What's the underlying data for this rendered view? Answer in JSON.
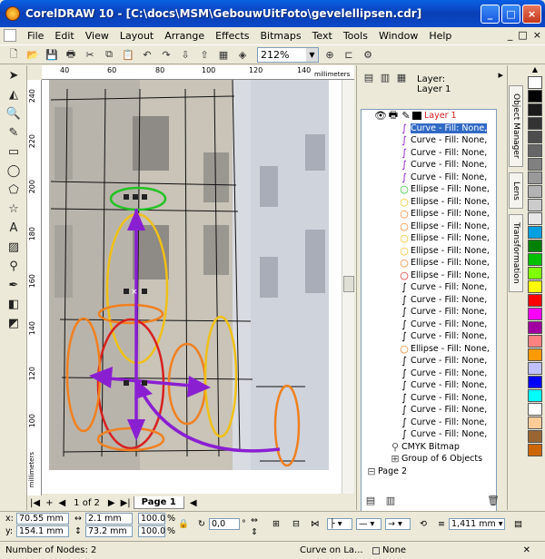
{
  "window": {
    "title": "CorelDRAW 10 - [C:\\docs\\MSM\\GebouwUitFoto\\gevelellipsen.cdr]",
    "minimize": "_",
    "restore": "□",
    "close": "×"
  },
  "menu": [
    "File",
    "Edit",
    "View",
    "Layout",
    "Arrange",
    "Effects",
    "Bitmaps",
    "Text",
    "Tools",
    "Window",
    "Help"
  ],
  "doc_controls": {
    "minimize": "_",
    "restore": "□",
    "close": "×"
  },
  "toolbar": {
    "zoom": "212%"
  },
  "hruler": {
    "ticks": [
      "40",
      "60",
      "80",
      "100",
      "120",
      "140"
    ],
    "unit": "millimeters"
  },
  "vruler": {
    "ticks": [
      "240",
      "220",
      "200",
      "180",
      "160",
      "140",
      "120",
      "100"
    ],
    "unit": "millimeters"
  },
  "pagebar": {
    "page_count": "1 of 2",
    "page_tab": "Page 1"
  },
  "docker": {
    "layer_line1": "Layer:",
    "layer_line2": "Layer 1"
  },
  "tree": {
    "layer": "Layer 1",
    "items": [
      {
        "label": "Curve - Fill: None,",
        "color": "#8a1fd1",
        "kind": "curve",
        "selected": true
      },
      {
        "label": "Curve - Fill: None,",
        "color": "#8a1fd1",
        "kind": "curve"
      },
      {
        "label": "Curve - Fill: None,",
        "color": "#8a1fd1",
        "kind": "curve"
      },
      {
        "label": "Curve - Fill: None,",
        "color": "#8a1fd1",
        "kind": "curve"
      },
      {
        "label": "Curve - Fill: None,",
        "color": "#8a1fd1",
        "kind": "curve"
      },
      {
        "label": "Ellipse - Fill: None,",
        "color": "#22c322",
        "kind": "ellipse"
      },
      {
        "label": "Ellipse - Fill: None,",
        "color": "#f0c018",
        "kind": "ellipse"
      },
      {
        "label": "Ellipse - Fill: None,",
        "color": "#f08020",
        "kind": "ellipse"
      },
      {
        "label": "Ellipse - Fill: None,",
        "color": "#f08020",
        "kind": "ellipse"
      },
      {
        "label": "Ellipse - Fill: None,",
        "color": "#f0c018",
        "kind": "ellipse"
      },
      {
        "label": "Ellipse - Fill: None,",
        "color": "#f0c018",
        "kind": "ellipse"
      },
      {
        "label": "Ellipse - Fill: None,",
        "color": "#f08020",
        "kind": "ellipse"
      },
      {
        "label": "Ellipse - Fill: None,",
        "color": "#d82020",
        "kind": "ellipse"
      },
      {
        "label": "Curve - Fill: None,",
        "color": "#000000",
        "kind": "curve"
      },
      {
        "label": "Curve - Fill: None,",
        "color": "#000000",
        "kind": "curve"
      },
      {
        "label": "Curve - Fill: None,",
        "color": "#000000",
        "kind": "curve"
      },
      {
        "label": "Curve - Fill: None,",
        "color": "#000000",
        "kind": "curve"
      },
      {
        "label": "Curve - Fill: None,",
        "color": "#000000",
        "kind": "curve"
      },
      {
        "label": "Ellipse - Fill: None,",
        "color": "#f08020",
        "kind": "ellipse"
      },
      {
        "label": "Curve - Fill: None,",
        "color": "#000000",
        "kind": "curve"
      },
      {
        "label": "Curve - Fill: None,",
        "color": "#000000",
        "kind": "curve"
      },
      {
        "label": "Curve - Fill: None,",
        "color": "#000000",
        "kind": "curve"
      },
      {
        "label": "Curve - Fill: None,",
        "color": "#000000",
        "kind": "curve"
      },
      {
        "label": "Curve - Fill: None,",
        "color": "#000000",
        "kind": "curve"
      },
      {
        "label": "Curve - Fill: None,",
        "color": "#000000",
        "kind": "curve"
      },
      {
        "label": "Curve - Fill: None,",
        "color": "#000000",
        "kind": "curve"
      },
      {
        "label": "CMYK Bitmap",
        "color": "#555555",
        "kind": "bitmap"
      },
      {
        "label": "Group of 6 Objects",
        "color": "#555555",
        "kind": "group"
      },
      {
        "label": "Page 2",
        "color": "#555555",
        "kind": "page"
      }
    ]
  },
  "side_tabs": [
    "Object Manager",
    "Lens",
    "Transformation"
  ],
  "palette": [
    "#ffffff",
    "#000000",
    "#1a1a1a",
    "#333333",
    "#4d4d4d",
    "#666666",
    "#808080",
    "#999999",
    "#b3b3b3",
    "#cccccc",
    "#e6e6e6",
    "#00a0e0",
    "#008000",
    "#00c000",
    "#80ff00",
    "#ffff00",
    "#ff0000",
    "#ff00ff",
    "#a000a0",
    "#ff8080",
    "#ff9900",
    "#c0c0ff",
    "#0000ff",
    "#00ffff",
    "#ffffff",
    "#ffcc99",
    "#996633",
    "#cc6600"
  ],
  "props": {
    "x": "70.55 mm",
    "y": "154.1 mm",
    "w": "2.1 mm",
    "h": "73.2 mm",
    "sx": "100.0",
    "sy": "100.0",
    "pct": "%",
    "angle": "0,0",
    "deg": "°",
    "outline_width": "1,411 mm"
  },
  "status": {
    "left": "Number of Nodes: 2",
    "mid": "Curve on La...",
    "fill": "None"
  }
}
